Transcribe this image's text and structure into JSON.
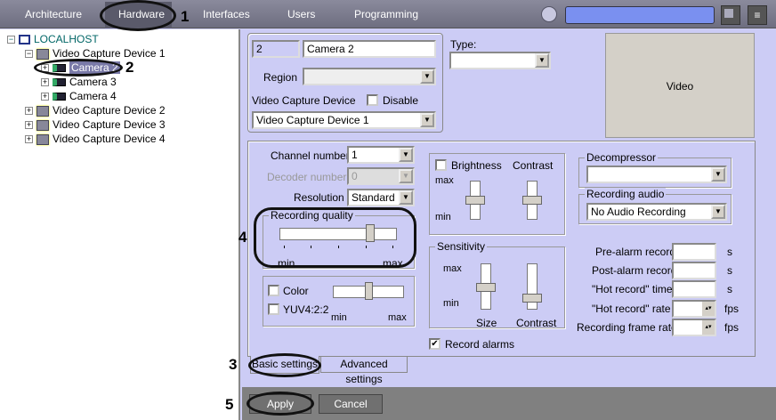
{
  "topbar": {
    "tabs": [
      "Architecture",
      "Hardware",
      "Interfaces",
      "Users",
      "Programming"
    ],
    "search_value": ""
  },
  "tree": {
    "root": "LOCALHOST",
    "device1": "Video Capture Device 1",
    "cameras": [
      "Camera 2",
      "Camera 3",
      "Camera 4"
    ],
    "devices": [
      "Video Capture Device 2",
      "Video Capture Device 3",
      "Video Capture Device 4"
    ]
  },
  "camera": {
    "id": "2",
    "name": "Camera 2",
    "region_label": "Region",
    "region_value": "",
    "vcd_label": "Video Capture Device",
    "disable_label": "Disable",
    "vcd_value": "Video Capture Device 1",
    "type_label": "Type:",
    "type_value": "",
    "video_label": "Video"
  },
  "basic": {
    "channel_label": "Channel number",
    "channel_value": "1",
    "decoder_label": "Decoder number",
    "decoder_value": "0",
    "resolution_label": "Resolution",
    "resolution_value": "Standard",
    "rq_label": "Recording quality",
    "rq_value": 0.77,
    "min": "min",
    "max": "max",
    "color_label": "Color",
    "yuv_label": "YUV4:2:2",
    "color_slider_value": 0.5,
    "brightness_label": "Brightness",
    "contrast_label": "Contrast",
    "sensitivity_label": "Sensitivity",
    "size_label": "Size",
    "record_alarms_label": "Record alarms",
    "decompressor_label": "Decompressor",
    "decompressor_value": "",
    "rec_audio_label": "Recording audio",
    "rec_audio_value": "No Audio Recording",
    "prealarm_label": "Pre-alarm record",
    "postalarm_label": "Post-alarm record",
    "hot_time_label": "\"Hot record\" time",
    "hot_rate_label": "\"Hot record\" rate",
    "frame_rate_label": "Recording frame rate",
    "unit_s": "s",
    "unit_fps": "fps"
  },
  "tabs": {
    "basic": "Basic settings",
    "advanced": "Advanced settings"
  },
  "buttons": {
    "apply": "Apply",
    "cancel": "Cancel"
  },
  "annotations": [
    "1",
    "2",
    "3",
    "4",
    "5"
  ]
}
